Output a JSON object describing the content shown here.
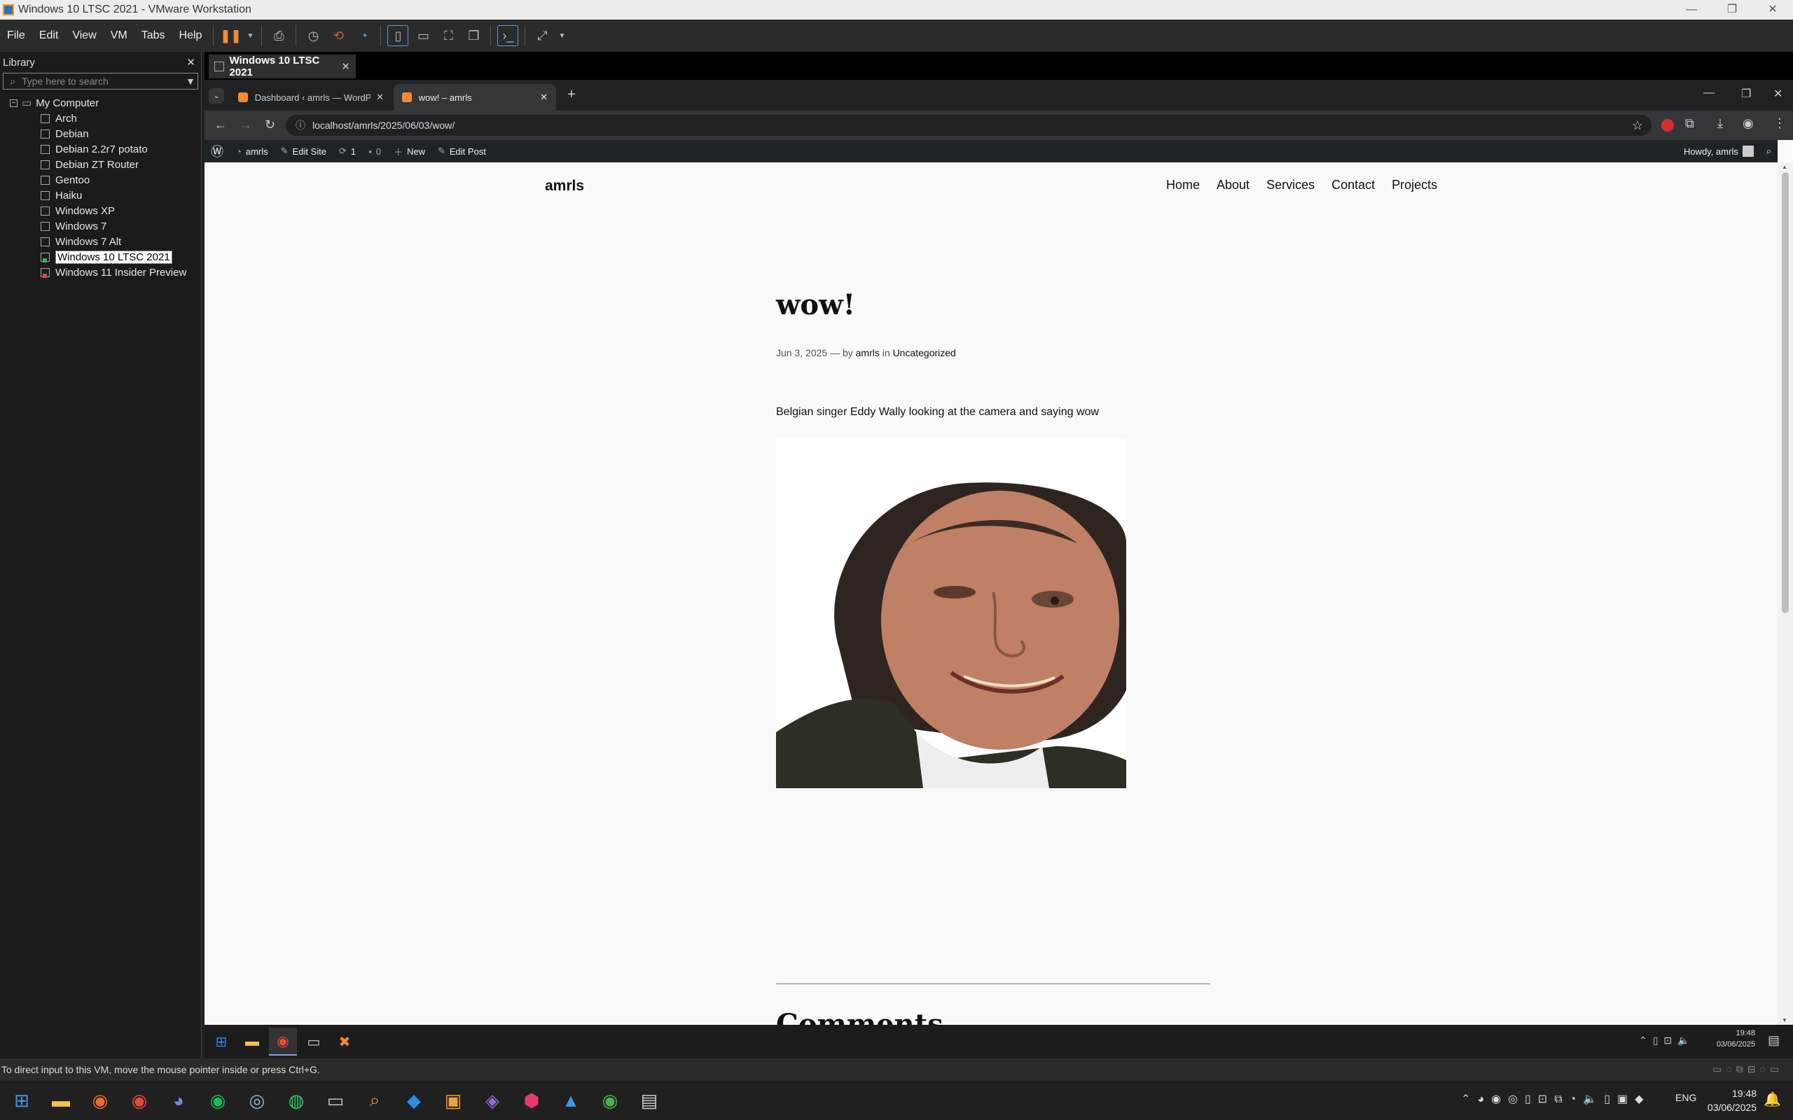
{
  "window": {
    "title": "Windows 10 LTSC 2021 - VMware Workstation",
    "min": "—",
    "max": "❐",
    "close": "✕"
  },
  "menus": [
    "File",
    "Edit",
    "View",
    "VM",
    "Tabs",
    "Help"
  ],
  "library": {
    "title": "Library",
    "close": "✕",
    "search_placeholder": "Type here to search",
    "root": "My Computer",
    "vms": [
      {
        "label": "Arch",
        "state": ""
      },
      {
        "label": "Debian",
        "state": ""
      },
      {
        "label": "Debian 2.2r7 potato",
        "state": ""
      },
      {
        "label": "Debian ZT Router",
        "state": ""
      },
      {
        "label": "Gentoo",
        "state": ""
      },
      {
        "label": "Haiku",
        "state": ""
      },
      {
        "label": "Windows XP",
        "state": ""
      },
      {
        "label": "Windows 7",
        "state": ""
      },
      {
        "label": "Windows 7 Alt",
        "state": ""
      },
      {
        "label": "Windows 10 LTSC 2021",
        "state": "run"
      },
      {
        "label": "Windows 11 Insider Preview",
        "state": "off"
      }
    ]
  },
  "vm_tab": {
    "label": "Windows 10 LTSC 2021",
    "close": "✕"
  },
  "browser": {
    "tabs": [
      {
        "label": "Dashboard ‹ amrls — WordPre",
        "close": "✕"
      },
      {
        "label": "wow! – amrls",
        "close": "✕"
      }
    ],
    "new_tab": "+",
    "url": "localhost/amrls/2025/06/03/wow/"
  },
  "wpbar": {
    "site": "amrls",
    "edit_site": "Edit Site",
    "updates": "1",
    "comments": "0",
    "new": "New",
    "edit_post": "Edit Post",
    "howdy": "Howdy, amrls"
  },
  "site": {
    "title": "amrls",
    "nav": [
      "Home",
      "About",
      "Services",
      "Contact",
      "Projects"
    ]
  },
  "post": {
    "title": "wow!",
    "date": "Jun 3, 2025",
    "dash": "—",
    "by": "by",
    "author": "amrls",
    "in": "in",
    "category": "Uncategorized",
    "text": "Belgian singer Eddy Wally looking at the camera and saying wow",
    "comments_heading": "Comments"
  },
  "guest_clock": {
    "time": "19:48",
    "date": "03/06/2025"
  },
  "status": "To direct input to this VM, move the mouse pointer inside or press Ctrl+G.",
  "host_clock": {
    "time": "19:48",
    "date": "03/06/2025",
    "lang": "ENG"
  }
}
